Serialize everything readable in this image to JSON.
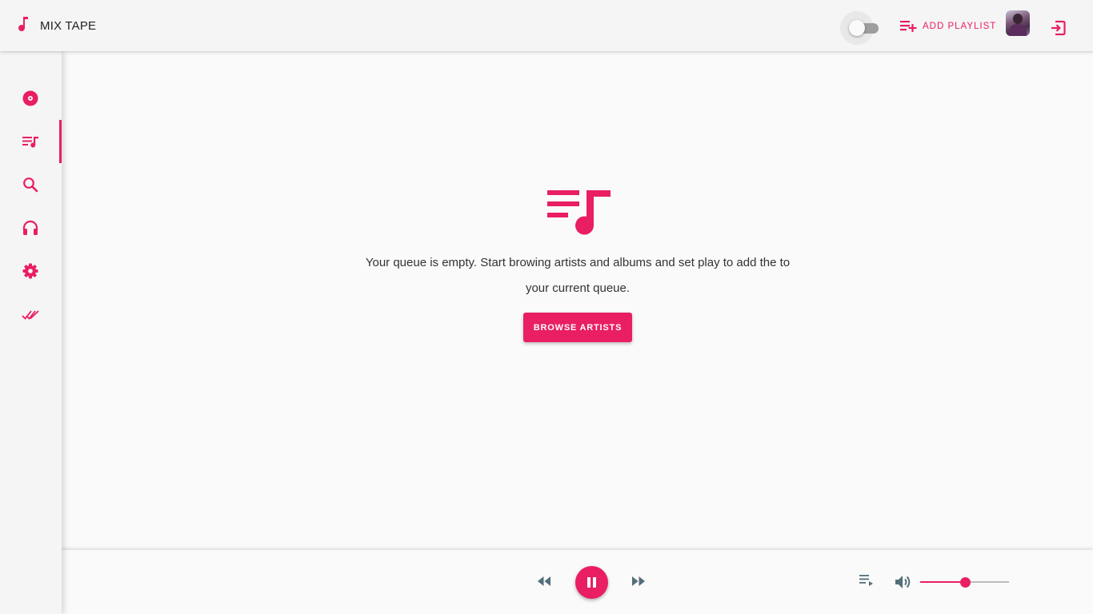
{
  "app": {
    "title": "MIX TAPE",
    "accent_color": "#e91e63",
    "logo_icon": "music-note-icon"
  },
  "header": {
    "theme_toggle": {
      "checked": false
    },
    "add_playlist_label": "ADD PLAYLIST",
    "add_playlist_icon": "playlist-add-icon",
    "avatar_icon": "user-avatar",
    "logout_icon": "logout-icon"
  },
  "sidebar": {
    "items": [
      {
        "name": "albums",
        "icon": "disc-icon",
        "active": false
      },
      {
        "name": "queue",
        "icon": "queue-music-icon",
        "active": true
      },
      {
        "name": "search",
        "icon": "search-icon",
        "active": false
      },
      {
        "name": "listen",
        "icon": "headphones-icon",
        "active": false
      },
      {
        "name": "settings",
        "icon": "gear-icon",
        "active": false
      },
      {
        "name": "completed",
        "icon": "double-check-icon",
        "active": false
      }
    ]
  },
  "queue": {
    "empty_icon": "queue-music-icon",
    "empty_message": "Your queue is empty. Start browing artists and albums and set play to add the to your current queue.",
    "browse_button_label": "BROWSE ARTISTS"
  },
  "player": {
    "state": "playing",
    "controls": [
      "rewind-icon",
      "pause-icon",
      "fast-forward-icon"
    ],
    "queue_icon": "queue-list-icon",
    "volume_icon": "volume-up-icon",
    "volume": 0.5
  }
}
